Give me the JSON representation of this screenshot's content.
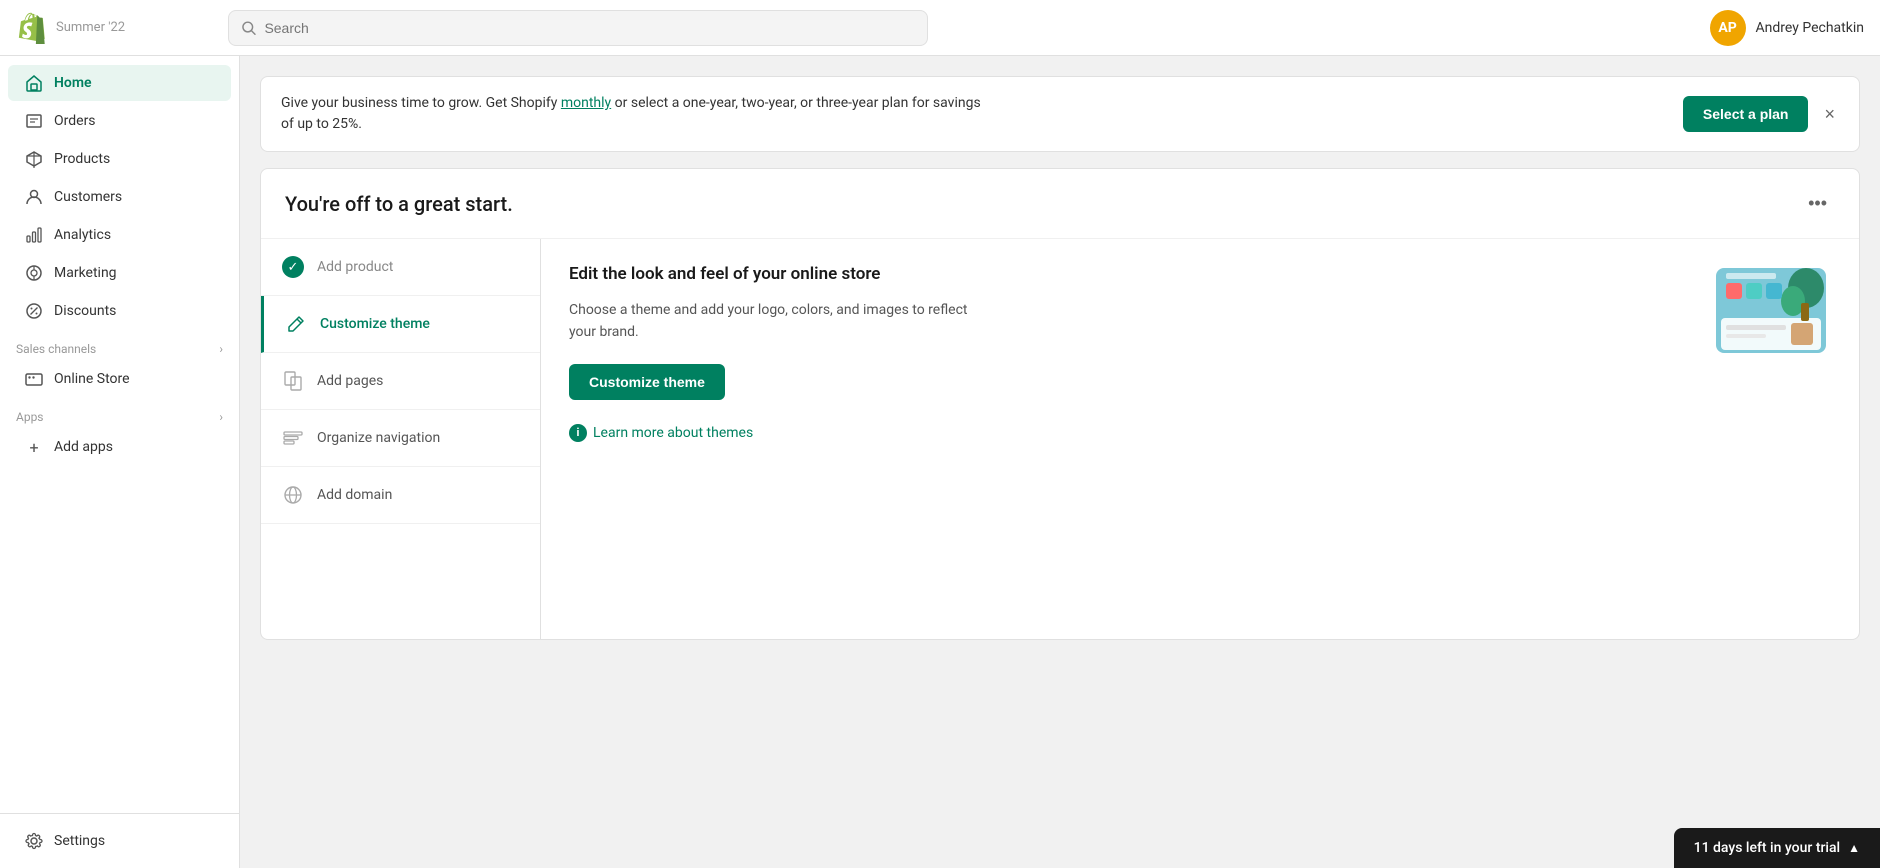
{
  "topbar": {
    "logo_label": "Shopify",
    "store_tag": "Summer '22",
    "search_placeholder": "Search",
    "user_initials": "AP",
    "user_name": "Andrey Pechatkin"
  },
  "sidebar": {
    "nav_items": [
      {
        "id": "home",
        "label": "Home",
        "icon": "home-icon",
        "active": true
      },
      {
        "id": "orders",
        "label": "Orders",
        "icon": "orders-icon",
        "active": false
      },
      {
        "id": "products",
        "label": "Products",
        "icon": "products-icon",
        "active": false
      },
      {
        "id": "customers",
        "label": "Customers",
        "icon": "customers-icon",
        "active": false
      },
      {
        "id": "analytics",
        "label": "Analytics",
        "icon": "analytics-icon",
        "active": false
      },
      {
        "id": "marketing",
        "label": "Marketing",
        "icon": "marketing-icon",
        "active": false
      },
      {
        "id": "discounts",
        "label": "Discounts",
        "icon": "discounts-icon",
        "active": false
      }
    ],
    "sales_channels_label": "Sales channels",
    "online_store_label": "Online Store",
    "apps_label": "Apps",
    "add_apps_label": "Add apps",
    "settings_label": "Settings"
  },
  "banner": {
    "text": "Give your business time to grow. Get Shopify monthly or select a one-year, two-year, or three-year plan for savings of up to 25%.",
    "monthly_link_text": "monthly",
    "select_plan_label": "Select a plan",
    "close_label": "×"
  },
  "setup_card": {
    "title": "You're off to a great start.",
    "more_label": "•••",
    "steps": [
      {
        "id": "add-product",
        "label": "Add product",
        "completed": true,
        "active": false
      },
      {
        "id": "customize-theme",
        "label": "Customize theme",
        "completed": false,
        "active": true
      },
      {
        "id": "add-pages",
        "label": "Add pages",
        "completed": false,
        "active": false
      },
      {
        "id": "organize-navigation",
        "label": "Organize navigation",
        "completed": false,
        "active": false
      },
      {
        "id": "add-domain",
        "label": "Add domain",
        "completed": false,
        "active": false
      }
    ],
    "active_step": {
      "title": "Edit the look and feel of your online store",
      "description": "Choose a theme and add your logo, colors, and images to reflect your brand.",
      "action_label": "Customize theme",
      "learn_more_label": "Learn more about themes"
    }
  },
  "trial": {
    "label": "11 days left in your trial",
    "chevron": "▲"
  }
}
